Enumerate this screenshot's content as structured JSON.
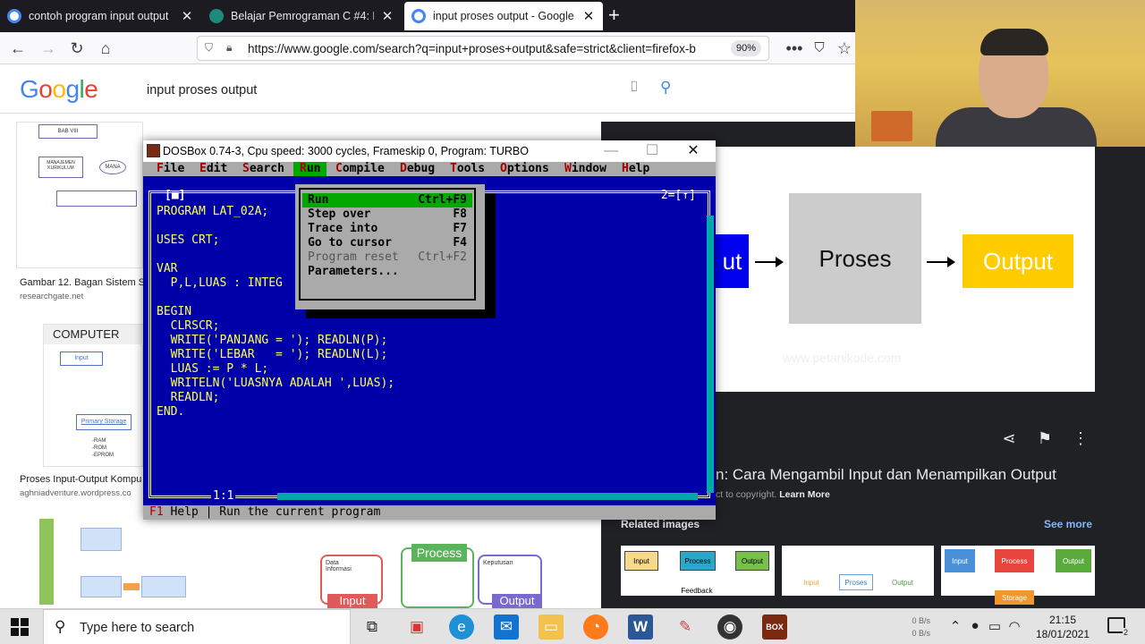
{
  "browser": {
    "tabs": [
      {
        "title": "contoh program input output",
        "favicon_color": "#4285f4",
        "active": false
      },
      {
        "title": "Belajar Pemrograman C #4: Me",
        "favicon_color": "#1e8a7a",
        "active": false
      },
      {
        "title": "input proses output - Google S",
        "favicon_color": "#4285f4",
        "active": true
      }
    ],
    "url": "https://www.google.com/search?q=input+proses+output&safe=strict&client=firefox-b",
    "zoom": "90%"
  },
  "google": {
    "logo": [
      "G",
      "o",
      "o",
      "g",
      "l",
      "e"
    ],
    "logo_colors": [
      "#4285f4",
      "#ea4335",
      "#fbbc05",
      "#4285f4",
      "#34a853",
      "#ea4335"
    ],
    "query": "input proses output",
    "results": [
      {
        "caption": "Gambar 12. Bagan Sistem S",
        "site": "researchgate.net",
        "diagram": [
          "BAB VIII",
          "MANAJEMEN KURIKULUM",
          "MANA"
        ]
      },
      {
        "caption": "Proses Input-Output Kompu",
        "site": "aghniadventure.wordpress.co",
        "diagram": [
          "COMPUTER",
          "Input",
          "Primary Storage",
          "-RAM",
          "-ROM",
          "-EPROM"
        ]
      },
      {
        "caption": "",
        "site": "",
        "diagram": [
          "Data",
          "Informasi",
          "Process",
          "Input",
          "Output",
          "Keputusan"
        ]
      }
    ]
  },
  "preview": {
    "box_left": "ut",
    "box_mid": "Proses",
    "box_right": "Output",
    "watermark": "www.petanikode.com",
    "title": "n: Cara Mengambil Input dan Menampilkan Output",
    "copyright": "ct to copyright.",
    "learn_more": "Learn More",
    "related_label": "Related images",
    "see_more": "See more",
    "related": [
      {
        "labels": [
          "Input",
          "Process",
          "Output",
          "Feedback"
        ]
      },
      {
        "labels": [
          "Input",
          "Proses",
          "Output"
        ]
      },
      {
        "labels": [
          "Input",
          "Process",
          "Output",
          "Storage"
        ]
      }
    ]
  },
  "dosbox": {
    "title": "DOSBox 0.74-3, Cpu speed:    3000 cycles, Frameskip  0, Program:   TURBO",
    "menu": [
      {
        "hk": "F",
        "rest": "ile"
      },
      {
        "hk": "E",
        "rest": "dit"
      },
      {
        "hk": "S",
        "rest": "earch"
      },
      {
        "hk": "R",
        "rest": "un",
        "selected": true
      },
      {
        "hk": "C",
        "rest": "ompile"
      },
      {
        "hk": "D",
        "rest": "ebug"
      },
      {
        "hk": "T",
        "rest": "ools"
      },
      {
        "hk": "O",
        "rest": "ptions"
      },
      {
        "hk": "W",
        "rest": "indow"
      },
      {
        "hk": "H",
        "rest": "elp"
      }
    ],
    "run_menu": [
      {
        "label": "Run",
        "key": "Ctrl+F9",
        "selected": true
      },
      {
        "label": "Step over",
        "key": "F8"
      },
      {
        "label": "Trace into",
        "key": "F7"
      },
      {
        "label": "Go to cursor",
        "key": "F4"
      },
      {
        "label": "Program reset",
        "key": "Ctrl+F2",
        "disabled": true
      },
      {
        "label": "Parameters...",
        "key": ""
      }
    ],
    "code": [
      "PROGRAM LAT_02A;",
      "",
      "USES CRT;",
      "",
      "VAR",
      "  P,L,LUAS : INTEG",
      "",
      "BEGIN",
      "  CLRSCR;",
      "  WRITE('PANJANG = '); READLN(P);",
      "  WRITE('LEBAR   = '); READLN(L);",
      "  LUAS := P * L;",
      "  WRITELN('LUASNYA ADALAH ',LUAS);",
      "  READLN;",
      "END."
    ],
    "window_number": "2=[↑]",
    "cursor_pos": "1:1",
    "status_key": "F1",
    "status_text": " Help | Run the current program"
  },
  "taskbar": {
    "search_placeholder": "Type here to search",
    "time": "21:15",
    "date": "18/01/2021",
    "net_up": "0 B/s",
    "net_down": "0 B/s",
    "notif_count": "2"
  }
}
